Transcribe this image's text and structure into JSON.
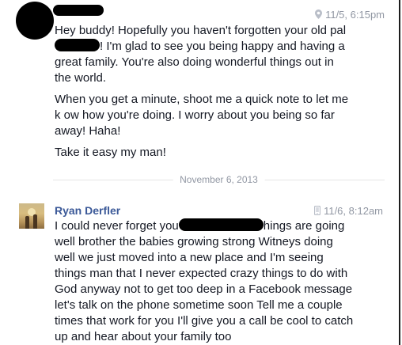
{
  "messages": [
    {
      "sender": "",
      "time": "11/5, 6:15pm",
      "time_icon": "location-pin-icon",
      "paragraph_1": {
        "line_1": "Hey buddy! Hopefully you haven't forgotten your old pal",
        "line_2_after_redaction": "! I'm glad to see you being happy and having a",
        "line_3": "great family. You're also doing wonderful things out in",
        "line_4": "the world."
      },
      "paragraph_2": {
        "line_1": "When you get a minute, shoot me a quick note to let me",
        "line_2": "k ow how you're doing. I worry about you being so far",
        "line_3": "away! Haha!"
      },
      "paragraph_3": {
        "line_1": "Take it easy my man!"
      }
    },
    {
      "sender": "Ryan Derfler",
      "time": "11/6, 8:12am",
      "time_icon": "mobile-phone-icon",
      "paragraph_1": {
        "line_1_before_redaction": "I could never forget you",
        "line_1_after_redaction": "hings are going",
        "line_2": "well brother the babies growing strong Witneys doing",
        "line_3": "well we just moved into a new place and I'm seeing",
        "line_4": "things man that I never expected crazy things to do with",
        "line_5": "God anyway not to get too deep in a Facebook message",
        "line_6": "let's talk on the phone sometime soon Tell me a couple",
        "line_7": "times that work for you I'll give you a call be cool to catch",
        "line_8": "up and hear about your family too"
      }
    }
  ],
  "date_divider": "November 6, 2013",
  "colors": {
    "sender_name": "#3b5998",
    "meta_text": "#9197a3",
    "body_text": "#141823",
    "redaction": "#000000"
  }
}
